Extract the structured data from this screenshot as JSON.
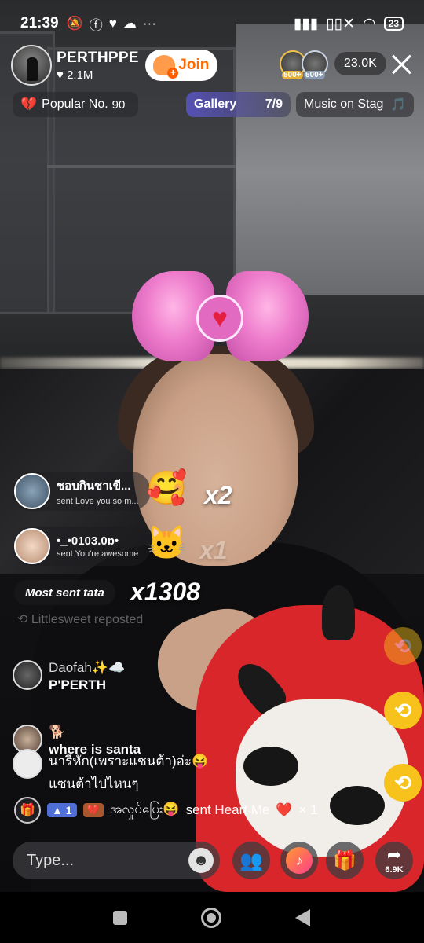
{
  "status_bar": {
    "time": "21:39",
    "battery": "23"
  },
  "host": {
    "name": "PERTHPPE",
    "likes": "2.1M",
    "join_label": "Join"
  },
  "viewers": {
    "badge_1": "500+",
    "badge_2": "500+",
    "count": "23.0K"
  },
  "pills": {
    "popular_label": "Popular No.",
    "popular_rank": "90",
    "gallery_label": "Gallery",
    "gallery_count": "7/9",
    "music_label": "Music on Stag"
  },
  "gifts": [
    {
      "name": "ชอบกินชาเขี...",
      "message": "sent Love you so m...",
      "combo": "x2"
    },
    {
      "name": "•_•0103.0ɒ•",
      "message": "sent You're awesome",
      "combo": "x1"
    }
  ],
  "most_sent": {
    "label": "Most sent tata",
    "combo": "x1308"
  },
  "repost_notice": "Littlesweet reposted",
  "comments": [
    {
      "user": "Daofah✨☁️",
      "text": "P'PERTH"
    },
    {
      "user": "🐕",
      "text": "where is santa"
    },
    {
      "user": "",
      "text": "นารีหัก(เพราะแซนต้า)อ่ะ😝"
    },
    {
      "user": "",
      "text": "แซนต้าไปไหนๆ"
    }
  ],
  "gift_line": {
    "level": "1",
    "fan_icon": "heart-icon",
    "user": "အလှုပ်ပြေး😝",
    "text": "sent Heart Me",
    "count": "× 1"
  },
  "input": {
    "placeholder": "Type..."
  },
  "bottom_bar": {
    "share_count": "6.9K"
  },
  "colors": {
    "join": "#ff6a00",
    "repost": "#f6c21b",
    "gallery": "#5a55c8",
    "accent": "#ff2d6b"
  }
}
